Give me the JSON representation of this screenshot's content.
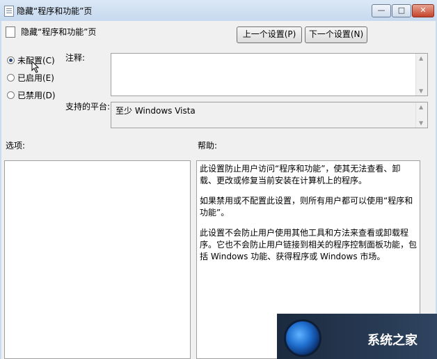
{
  "window": {
    "title": "隐藏“程序和功能”页",
    "buttons": {
      "minimize": "—",
      "maximize": "□",
      "close": "✕"
    }
  },
  "header": {
    "title": "隐藏“程序和功能”页",
    "prev_button": "上一个设置(P)",
    "next_button": "下一个设置(N)"
  },
  "state": {
    "options": [
      {
        "label": "未配置(C)",
        "selected": true
      },
      {
        "label": "已启用(E)",
        "selected": false
      },
      {
        "label": "已禁用(D)",
        "selected": false
      }
    ]
  },
  "comment": {
    "label": "注释:",
    "value": ""
  },
  "platform": {
    "label": "支持的平台:",
    "value": "至少 Windows Vista"
  },
  "options_section": {
    "label": "选项:"
  },
  "help_section": {
    "label": "帮助:",
    "paragraphs": [
      "此设置防止用户访问“程序和功能”，使其无法查看、卸载、更改或修复当前安装在计算机上的程序。",
      "如果禁用或不配置此设置，则所有用户都可以使用“程序和功能”。",
      "此设置不会防止用户使用其他工具和方法来查看或卸载程序。它也不会防止用户链接到相关的程序控制面板功能，包括 Windows 功能、获得程序或 Windows 市场。"
    ]
  },
  "watermark": {
    "text": "系统之家"
  }
}
